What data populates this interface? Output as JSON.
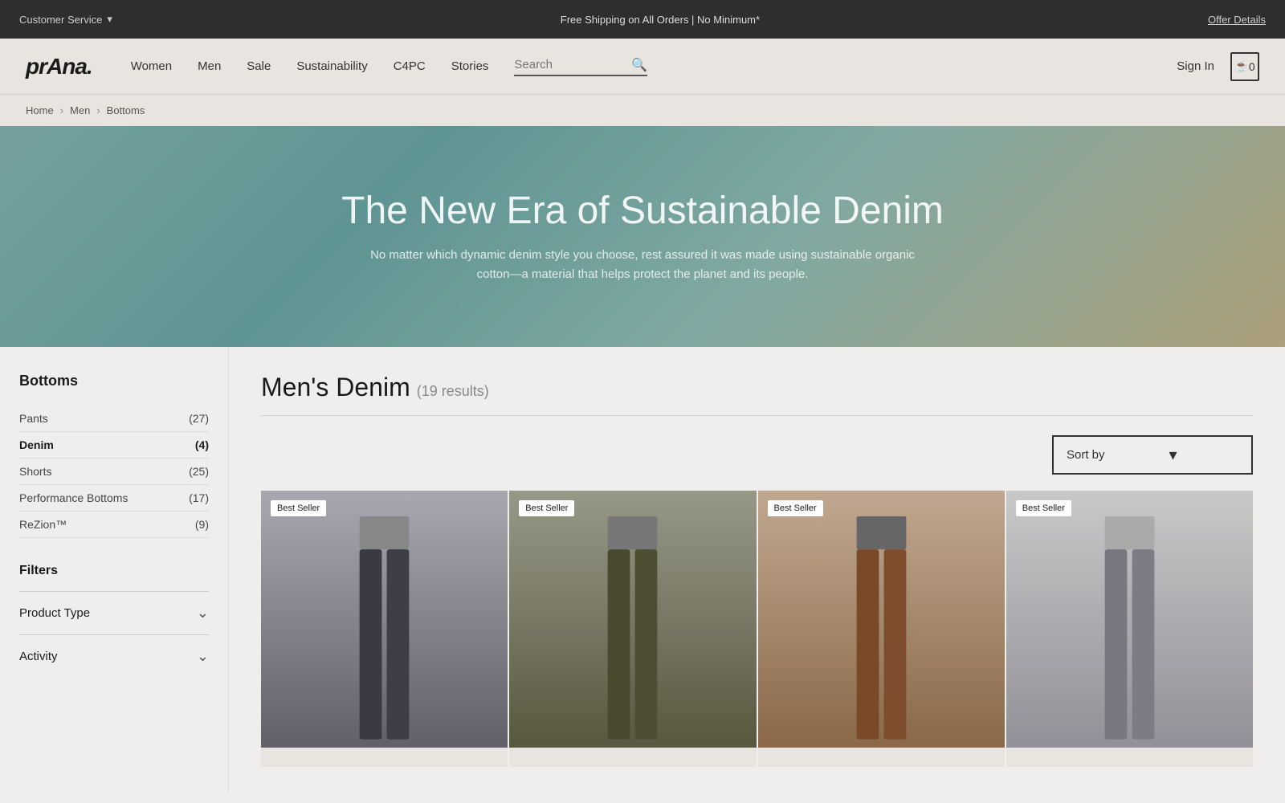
{
  "topbar": {
    "customer_service": "Customer Service",
    "chevron": "▾",
    "promo": "Free Shipping on All Orders | No Minimum*",
    "offer_details": "Offer Details"
  },
  "nav": {
    "logo": "prAna.",
    "links": [
      {
        "label": "Women"
      },
      {
        "label": "Men"
      },
      {
        "label": "Sale"
      },
      {
        "label": "Sustainability"
      },
      {
        "label": "C4PC"
      },
      {
        "label": "Stories"
      }
    ],
    "search_placeholder": "Search",
    "search_label": "Search",
    "signin": "Sign In",
    "cart_count": "0"
  },
  "breadcrumb": {
    "home": "Home",
    "men": "Men",
    "current": "Bottoms"
  },
  "hero": {
    "title": "The New Era of Sustainable Denim",
    "subtitle": "No matter which dynamic denim style you choose, rest assured it was made using sustainable organic cotton—a material that helps protect the planet and its people."
  },
  "sidebar": {
    "title": "Bottoms",
    "categories": [
      {
        "label": "Pants",
        "count": "(27)",
        "active": false
      },
      {
        "label": "Denim",
        "count": "(4)",
        "active": true
      },
      {
        "label": "Shorts",
        "count": "(25)",
        "active": false
      },
      {
        "label": "Performance Bottoms",
        "count": "(17)",
        "active": false
      },
      {
        "label": "ReZion™",
        "count": "(9)",
        "active": false
      }
    ],
    "filters_title": "Filters",
    "filter_groups": [
      {
        "label": "Product Type"
      },
      {
        "label": "Activity"
      }
    ]
  },
  "content": {
    "title": "Men's Denim",
    "count": "(19 results)",
    "sort_label": "Sort by",
    "sort_chevron": "▾",
    "products": [
      {
        "badge": "Best Seller",
        "pants_color": "#4a4a52"
      },
      {
        "badge": "Best Seller",
        "pants_color": "#5a5a40"
      },
      {
        "badge": "Best Seller",
        "pants_color": "#7a4a28"
      },
      {
        "badge": "Best Seller",
        "pants_color": "#888890"
      }
    ]
  }
}
